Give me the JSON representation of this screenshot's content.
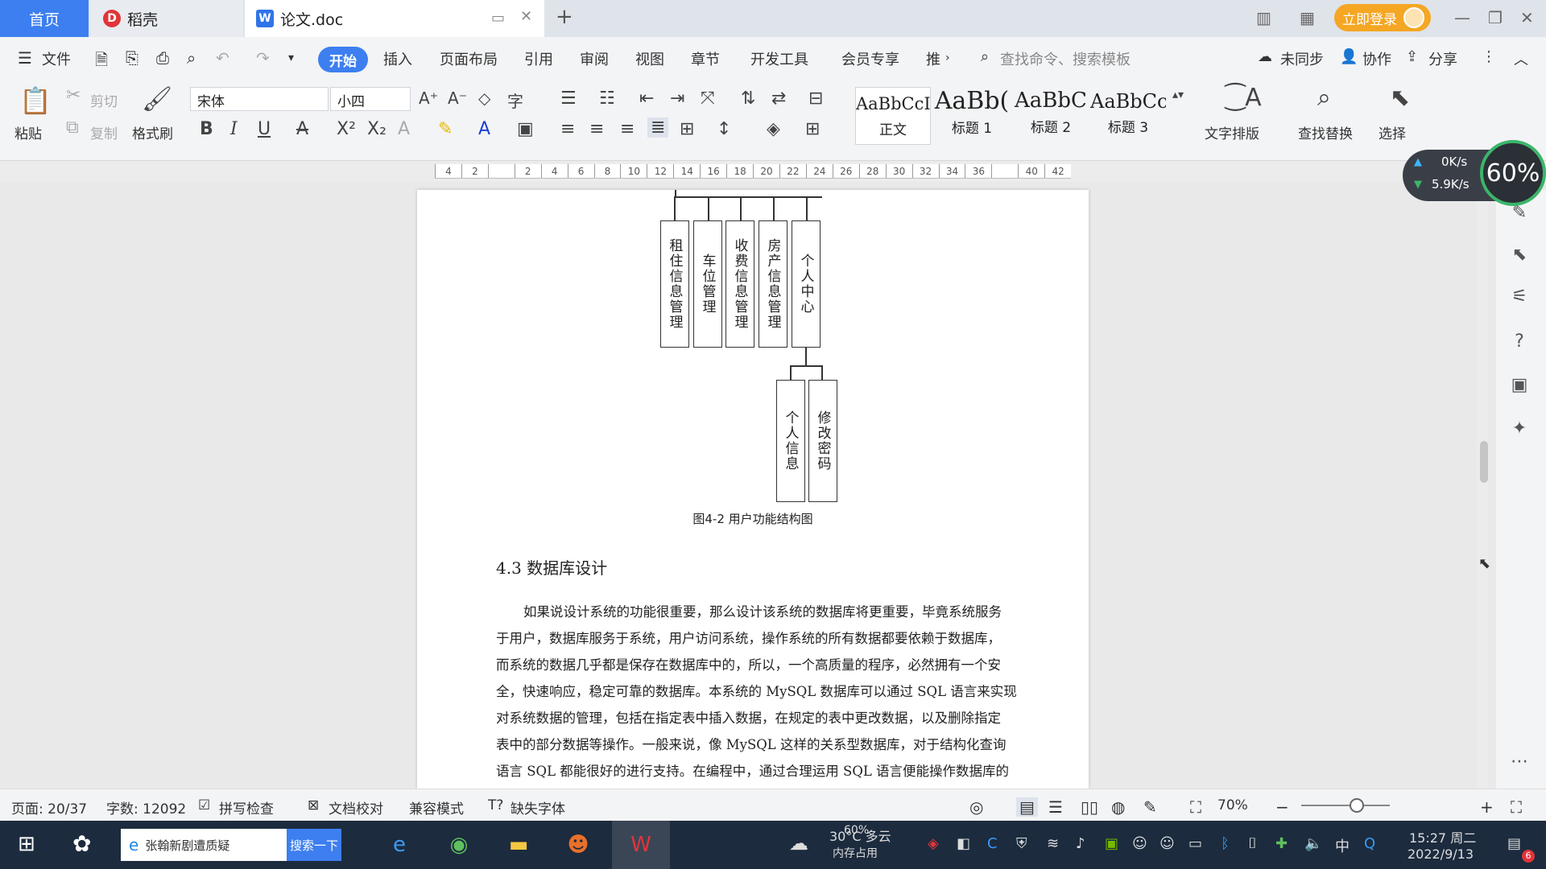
{
  "tabs": {
    "home": "首页",
    "docer": "稻壳",
    "document": "论文.doc",
    "login": "立即登录"
  },
  "menu": {
    "file": "文件",
    "items": [
      "开始",
      "插入",
      "页面布局",
      "引用",
      "审阅",
      "视图",
      "章节",
      "开发工具",
      "会员专享",
      "推"
    ],
    "search_placeholder": "查找命令、搜索模板",
    "sync": "未同步",
    "collab": "协作",
    "share": "分享"
  },
  "ribbon": {
    "paste": "粘贴",
    "cut": "剪切",
    "copy": "复制",
    "format_painter": "格式刷",
    "font_name": "宋体",
    "font_size": "小四",
    "styles": [
      {
        "sample": "AaBbCcI",
        "name": "正文"
      },
      {
        "sample": "AaBb(",
        "name": "标题 1"
      },
      {
        "sample": "AaBbC",
        "name": "标题 2"
      },
      {
        "sample": "AaBbCc",
        "name": "标题 3"
      }
    ],
    "text_layout": "文字排版",
    "find_replace": "查找替换",
    "select": "选择"
  },
  "ruler": {
    "ticks": [
      "4",
      "2",
      "",
      "2",
      "4",
      "6",
      "8",
      "10",
      "12",
      "14",
      "16",
      "18",
      "20",
      "22",
      "24",
      "26",
      "28",
      "30",
      "32",
      "34",
      "36",
      "",
      "40",
      "42"
    ]
  },
  "document": {
    "diagram_boxes": [
      "租住信息管理",
      "车位管理",
      "收费信息管理",
      "房产信息管理",
      "个人中心"
    ],
    "sub_boxes": [
      "个人信息",
      "修改密码"
    ],
    "caption": "图4-2  用户功能结构图",
    "heading": "4.3 数据库设计",
    "paragraph_lines": [
      "如果说设计系统的功能很重要，那么设计该系统的数据库将更重要，毕竟系统服务",
      "于用户，数据库服务于系统，用户访问系统，操作系统的所有数据都要依赖于数据库，",
      "而系统的数据几乎都是保存在数据库中的，所以，一个高质量的程序，必然拥有一个安",
      "全，快速响应，稳定可靠的数据库。本系统的 MySQL 数据库可以通过 SQL 语言来实现",
      "对系统数据的管理，包括在指定表中插入数据，在规定的表中更改数据，以及删除指定",
      "表中的部分数据等操作。一般来说，像 MySQL 这样的关系型数据库，对于结构化查询",
      "语言 SQL 都能很好的进行支持。在编程中，通过合理运用 SQL 语言便能操作数据库的"
    ]
  },
  "speed_widget": {
    "upload": "0K/s",
    "download": "5.9K/s",
    "percent": "60%"
  },
  "status": {
    "page": "页面: 20/37",
    "words": "字数: 12092",
    "spell": "拼写检查",
    "proofread": "文档校对",
    "compat": "兼容模式",
    "missing_font": "缺失字体",
    "zoom": "70%"
  },
  "taskbar": {
    "search_text": "张翰新剧遭质疑",
    "search_btn": "搜索一下",
    "weather": "30°C 多云",
    "memory": "60%",
    "memory_label": "内存占用",
    "ime": "中",
    "time": "15:27 周二",
    "date": "2022/9/13",
    "notif_count": "6"
  },
  "colors": {
    "accent": "#3d7ff0",
    "login": "#f5a623",
    "taskbar": "#1c2b3e"
  }
}
